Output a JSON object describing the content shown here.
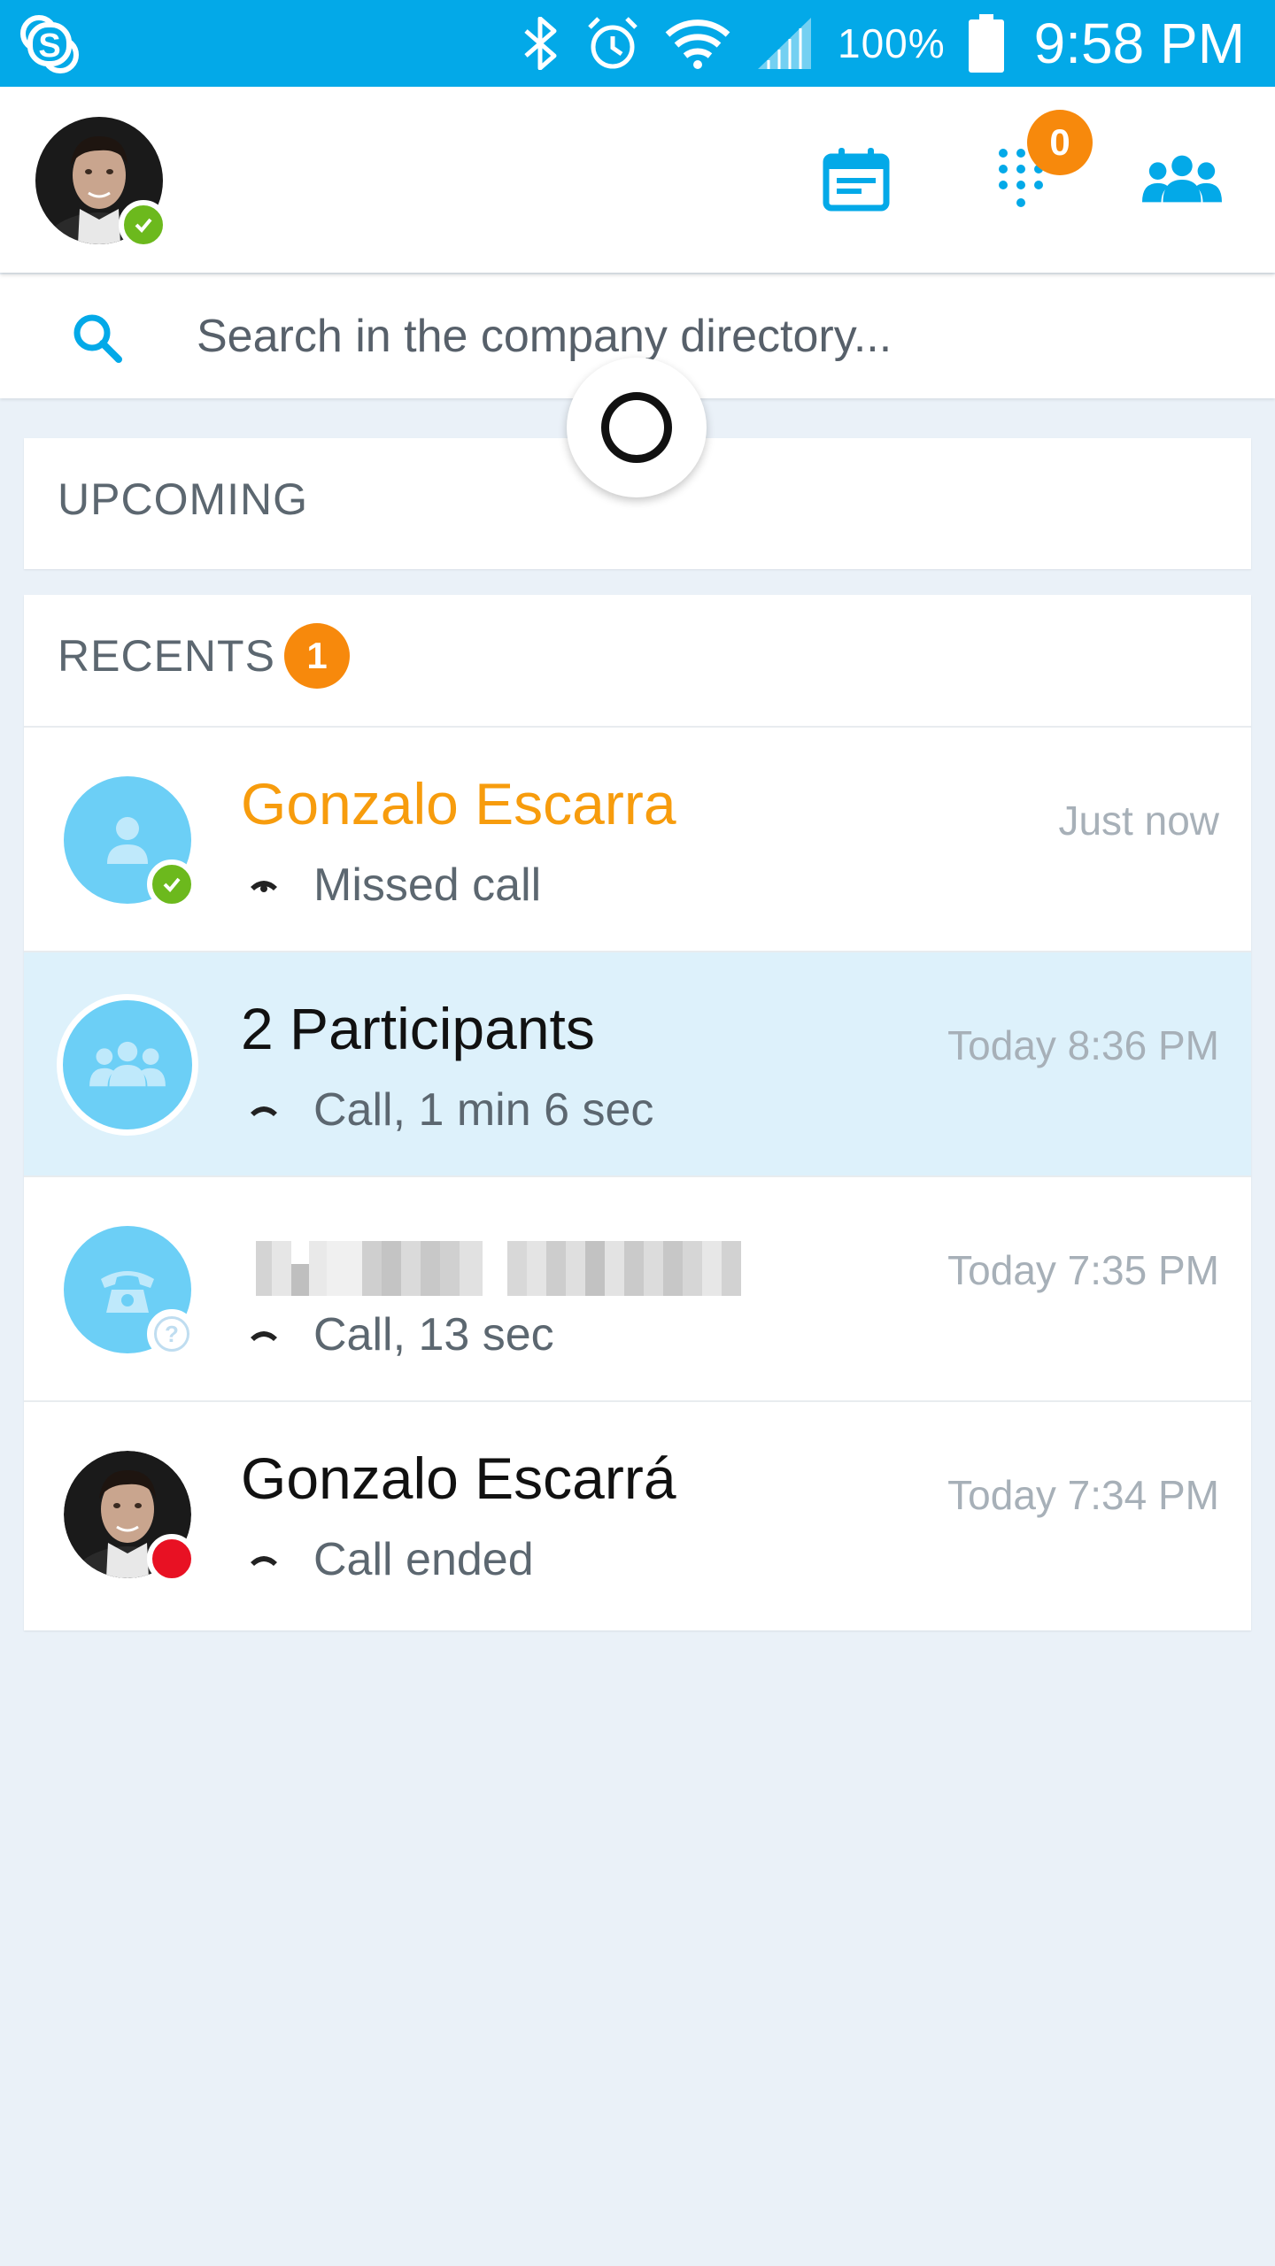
{
  "status_bar": {
    "battery": "100%",
    "time": "9:58 PM"
  },
  "app_bar": {
    "dialpad_badge": "0"
  },
  "search": {
    "placeholder": "Search in the company directory..."
  },
  "upcoming": {
    "title": "UPCOMING"
  },
  "recents": {
    "title": "RECENTS",
    "badge": "1",
    "items": [
      {
        "name": "Gonzalo Escarra",
        "detail": "Missed call",
        "time": "Just now",
        "presence": "online",
        "avatar": "person-icon",
        "missed": true
      },
      {
        "name": "2 Participants",
        "detail": "Call, 1 min 6 sec",
        "time": "Today 8:36 PM",
        "avatar": "group-icon",
        "selected": true
      },
      {
        "name": "",
        "detail": "Call, 13 sec",
        "time": "Today 7:35 PM",
        "presence": "unknown",
        "avatar": "phone-icon"
      },
      {
        "name": "Gonzalo Escarrá",
        "detail": "Call ended",
        "time": "Today 7:34 PM",
        "presence": "busy",
        "avatar": "photo"
      }
    ]
  },
  "colors": {
    "accent": "#03A9E8",
    "badge": "#F7890C",
    "missed": "#F79C0D",
    "online": "#6CB91D",
    "busy": "#E81123",
    "selected_row": "#DDF1FB"
  }
}
